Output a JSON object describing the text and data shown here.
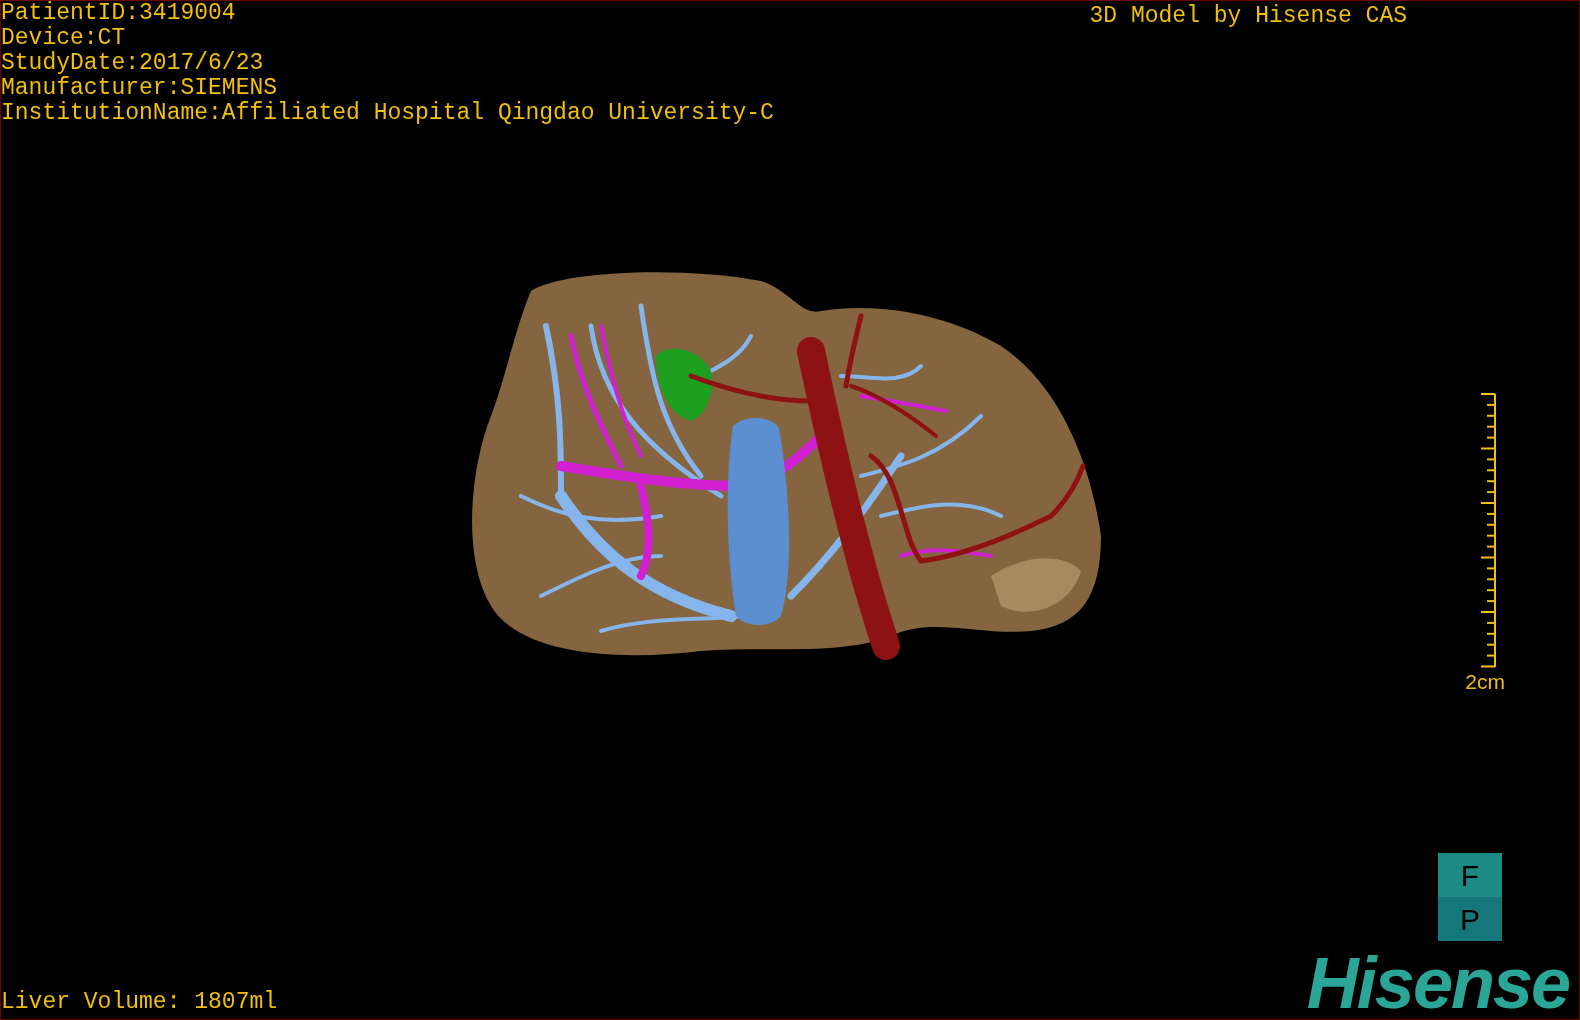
{
  "viewport": {
    "info_lines": [
      "PatientID:3419004",
      "Device:CT",
      "StudyDate:2017/6/23",
      "Manufacturer:SIEMENS",
      "InstitutionName:Affiliated Hospital Qingdao University-C"
    ],
    "title": "3D Model by Hisense CAS",
    "scale_label": "2cm",
    "orientation_marker": [
      "F",
      "P"
    ],
    "liver_volume": "Liver Volume: 1807ml",
    "logo": "Hisense"
  }
}
